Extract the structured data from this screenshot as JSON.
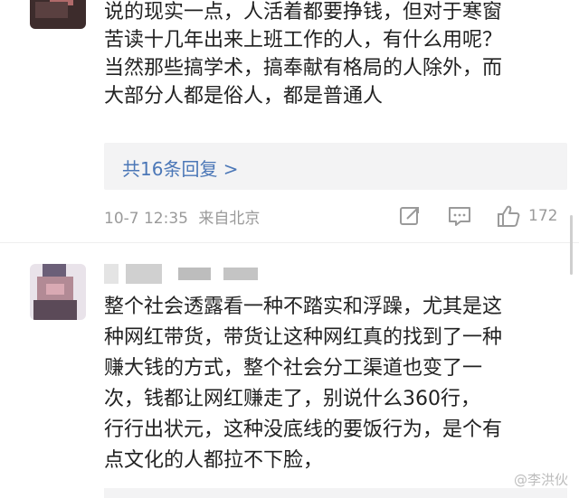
{
  "comment1": {
    "text": "说的现实一点，人活着都要挣钱，但对于寒窗\n苦读十几年出来上班工作的人，有什么用呢？\n当然那些搞学术，搞奉献有格局的人除外，而\n大部分人都是俗人，都是普通人",
    "replies_label": "共16条回复 >",
    "date": "10-7 12:35",
    "location": "来自北京",
    "like_count": "172",
    "icons": [
      "share-icon",
      "comment-icon",
      "like-icon"
    ]
  },
  "comment2": {
    "text": "整个社会透露看一种不踏实和浮躁，尤其是这\n种网红带货，带货让这种网红真的找到了一种\n赚大钱的方式，整个社会分工渠道也变了一\n次，钱都让网红赚走了，别说什么360行，\n行行出状元，这种没底线的要饭行为，是个有\n点文化的人都拉不下脸，"
  },
  "watermark": "@李洪伙"
}
